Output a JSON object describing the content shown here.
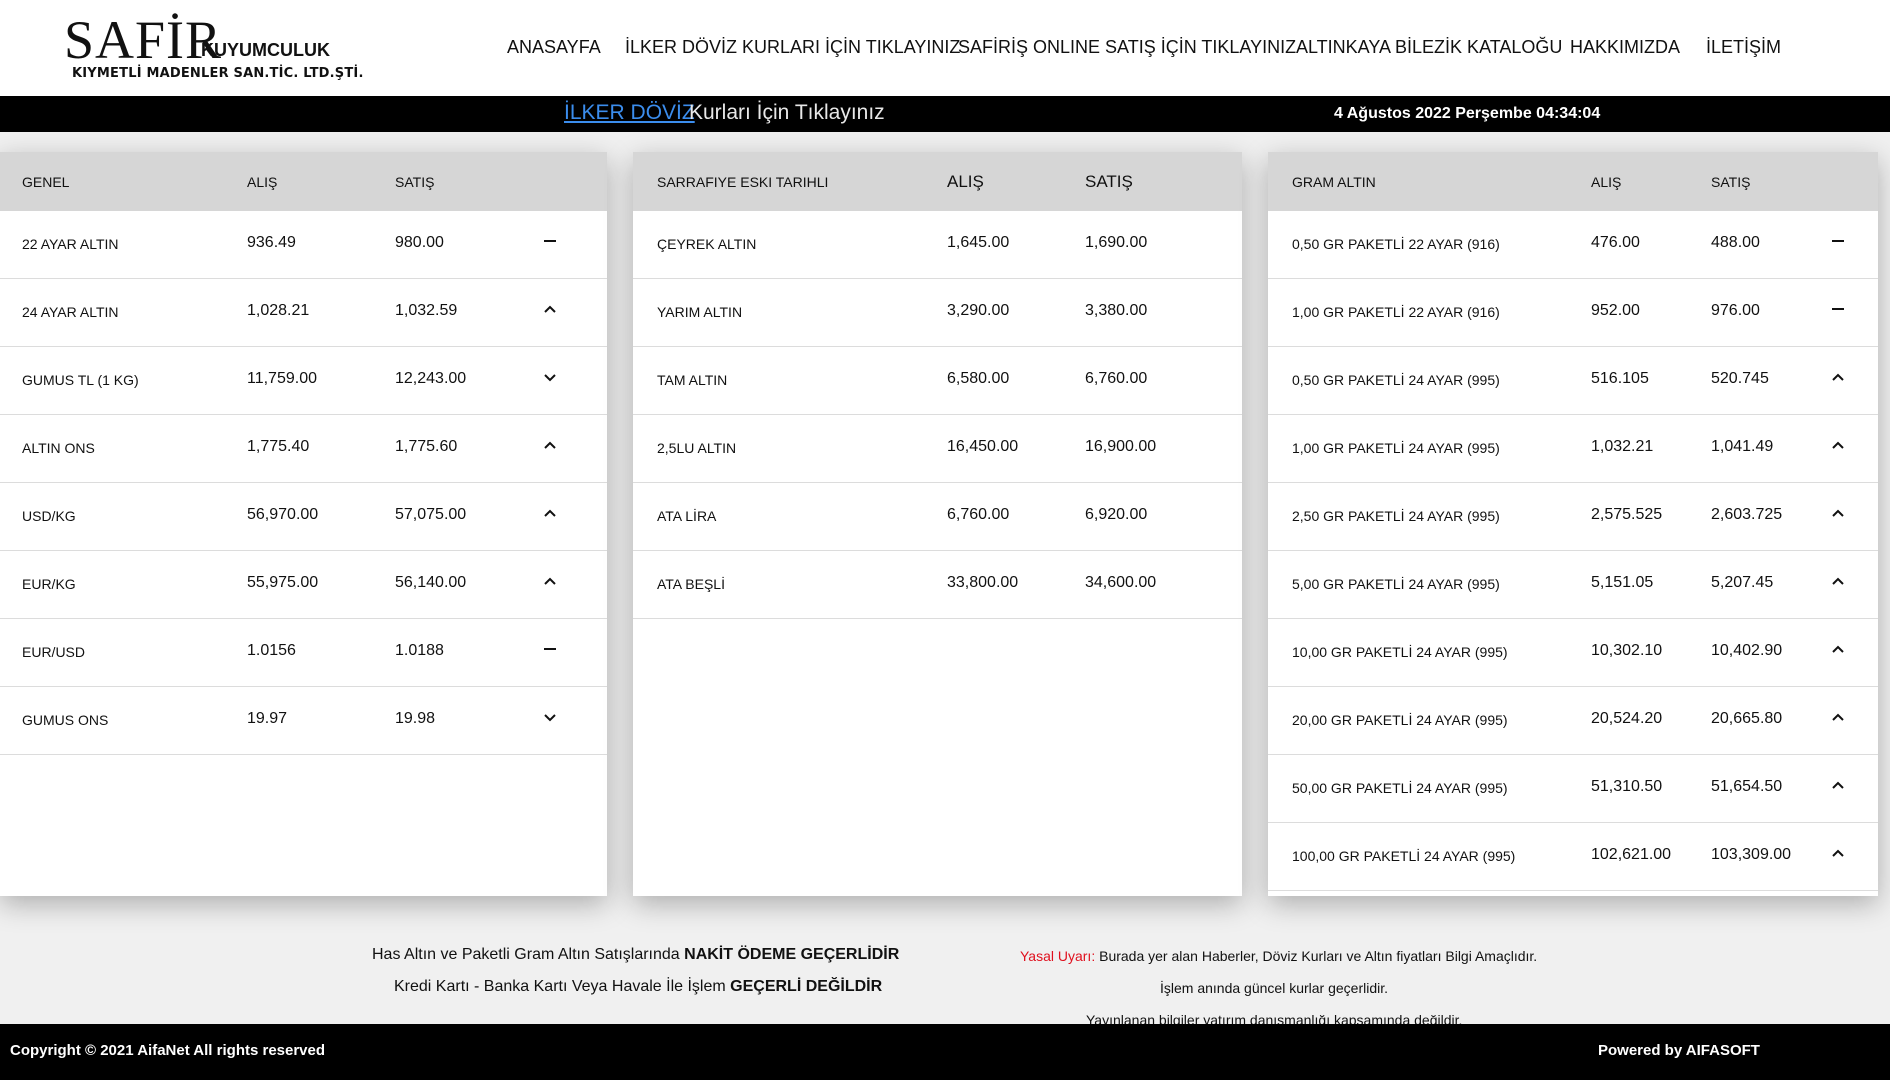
{
  "brand": {
    "name": "SAFİR",
    "suffix": "KUYUMCULUK",
    "tagline": "KIYMETLİ MADENLER SAN.TİC. LTD.ŞTİ."
  },
  "nav": [
    {
      "label": "ANASAYFA"
    },
    {
      "label": "İLKER DÖVİZ KURLARI İÇİN TIKLAYINIZ"
    },
    {
      "label": "SAFİRİŞ ONLINE SATIŞ İÇİN TIKLAYINIZ"
    },
    {
      "label": "ALTINKAYA BİLEZİK KATALOĞU"
    },
    {
      "label": "HAKKIMIZDA"
    },
    {
      "label": "İLETİŞİM"
    }
  ],
  "ticker": {
    "link": "İLKER DÖVİZ",
    "text": "Kurları İçin Tıklayınız",
    "datetime": "4 Ağustos 2022 Perşembe 04:34:04"
  },
  "panels": [
    {
      "headers": [
        "GENEL",
        "ALIŞ",
        "SATIŞ"
      ],
      "rows": [
        {
          "name": "22 AYAR ALTIN",
          "buy": "936.49",
          "sell": "980.00",
          "trend": "flat"
        },
        {
          "name": "24 AYAR ALTIN",
          "buy": "1,028.21",
          "sell": "1,032.59",
          "trend": "up"
        },
        {
          "name": "GUMUS TL (1 KG)",
          "buy": "11,759.00",
          "sell": "12,243.00",
          "trend": "down"
        },
        {
          "name": "ALTIN ONS",
          "buy": "1,775.40",
          "sell": "1,775.60",
          "trend": "up"
        },
        {
          "name": "USD/KG",
          "buy": "56,970.00",
          "sell": "57,075.00",
          "trend": "up"
        },
        {
          "name": "EUR/KG",
          "buy": "55,975.00",
          "sell": "56,140.00",
          "trend": "up"
        },
        {
          "name": "EUR/USD",
          "buy": "1.0156",
          "sell": "1.0188",
          "trend": "flat"
        },
        {
          "name": "GUMUS ONS",
          "buy": "19.97",
          "sell": "19.98",
          "trend": "down"
        }
      ]
    },
    {
      "headers": [
        "SARRAFIYE ESKI TARIHLI",
        "ALIŞ",
        "SATIŞ"
      ],
      "rows": [
        {
          "name": "ÇEYREK ALTIN",
          "buy": "1,645.00",
          "sell": "1,690.00",
          "trend": ""
        },
        {
          "name": "YARIM ALTIN",
          "buy": "3,290.00",
          "sell": "3,380.00",
          "trend": ""
        },
        {
          "name": "TAM ALTIN",
          "buy": "6,580.00",
          "sell": "6,760.00",
          "trend": ""
        },
        {
          "name": "2,5LU ALTIN",
          "buy": "16,450.00",
          "sell": "16,900.00",
          "trend": ""
        },
        {
          "name": "ATA LİRA",
          "buy": "6,760.00",
          "sell": "6,920.00",
          "trend": ""
        },
        {
          "name": "ATA BEŞLİ",
          "buy": "33,800.00",
          "sell": "34,600.00",
          "trend": ""
        }
      ]
    },
    {
      "headers": [
        "GRAM ALTIN",
        "ALIŞ",
        "SATIŞ"
      ],
      "rows": [
        {
          "name": "0,50 GR PAKETLİ 22 AYAR (916)",
          "buy": "476.00",
          "sell": "488.00",
          "trend": "flat"
        },
        {
          "name": "1,00 GR PAKETLİ 22 AYAR (916)",
          "buy": "952.00",
          "sell": "976.00",
          "trend": "flat"
        },
        {
          "name": "0,50 GR PAKETLİ 24 AYAR (995)",
          "buy": "516.105",
          "sell": "520.745",
          "trend": "up"
        },
        {
          "name": "1,00 GR PAKETLİ 24 AYAR (995)",
          "buy": "1,032.21",
          "sell": "1,041.49",
          "trend": "up"
        },
        {
          "name": "2,50 GR PAKETLİ 24 AYAR (995)",
          "buy": "2,575.525",
          "sell": "2,603.725",
          "trend": "up"
        },
        {
          "name": "5,00 GR PAKETLİ 24 AYAR (995)",
          "buy": "5,151.05",
          "sell": "5,207.45",
          "trend": "up"
        },
        {
          "name": "10,00 GR PAKETLİ 24 AYAR (995)",
          "buy": "10,302.10",
          "sell": "10,402.90",
          "trend": "up"
        },
        {
          "name": "20,00 GR PAKETLİ 24 AYAR (995)",
          "buy": "20,524.20",
          "sell": "20,665.80",
          "trend": "up"
        },
        {
          "name": "50,00 GR PAKETLİ 24 AYAR (995)",
          "buy": "51,310.50",
          "sell": "51,654.50",
          "trend": "up"
        },
        {
          "name": "100,00 GR PAKETLİ 24 AYAR (995)",
          "buy": "102,621.00",
          "sell": "103,309.00",
          "trend": "up"
        }
      ]
    }
  ],
  "notes": {
    "payment_line1_pre": "Has Altın ve Paketli Gram Altın Satışlarında ",
    "payment_line1_bold": "NAKİT ÖDEME GEÇERLİDİR",
    "payment_line2_pre": "Kredi Kartı - Banka Kartı Veya Havale İle İşlem ",
    "payment_line2_bold": "GEÇERLİ DEĞİLDİR",
    "legal_label": "Yasal Uyarı:",
    "legal_line1": " Burada yer alan Haberler, Döviz Kurları ve Altın fiyatları Bilgi Amaçlıdır.",
    "legal_line2": "İşlem anında güncel kurlar geçerlidir.",
    "legal_line3": "Yayınlanan bilgiler yatırım danışmanlığı kapsamında değildir."
  },
  "footer": {
    "copyright": "Copyright © 2021 AifaNet All rights reserved",
    "powered": "Powered by AIFASOFT"
  }
}
